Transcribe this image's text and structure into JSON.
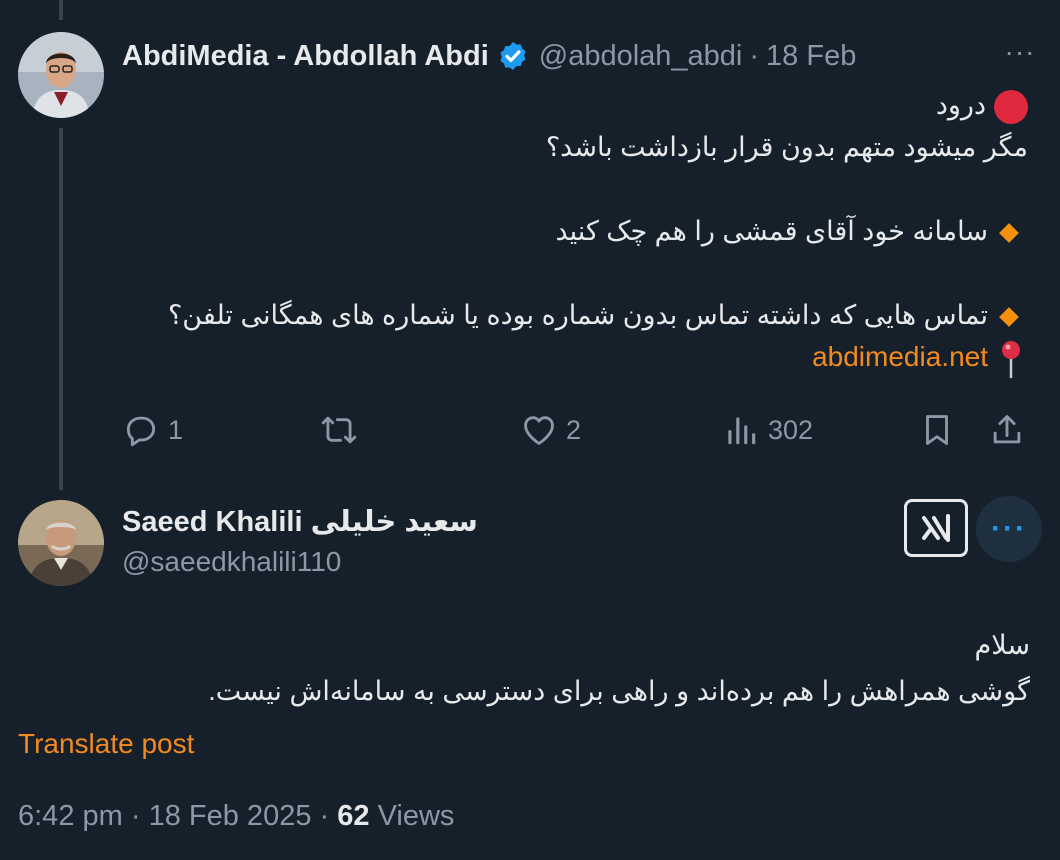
{
  "tweet1": {
    "display_name": "AbdiMedia - Abdollah Abdi",
    "handle": "@abdolah_abdi",
    "separator": "·",
    "date": "18 Feb",
    "more_label": "···",
    "lines": [
      "درود",
      "مگر میشود متهم بدون قرار بازداشت باشد؟",
      "سامانه خود آقای قمشی را هم چک کنید",
      "تماس هایی که داشته تماس بدون شماره بوده یا شماره های همگانی تلفن؟",
      "abdimedia.net"
    ],
    "actions": {
      "replies": "1",
      "likes": "2",
      "views": "302"
    }
  },
  "tweet2": {
    "display_name": "Saeed Khalili سعید خلیلی",
    "handle": "@saeedkhalili110",
    "more_label": "···",
    "lines": [
      "سلام",
      "گوشی همراهش را هم برده‌اند و راهی  برای دسترسی به سامانه‌اش نیست."
    ],
    "translate_label": "Translate post",
    "time": "6:42 pm",
    "separator": "·",
    "date": "18 Feb 2025",
    "views_count": "62",
    "views_label": "Views"
  },
  "colors": {
    "background": "#15202b",
    "text": "#e7e9ea",
    "muted": "#8b98a5",
    "accent": "#f48a1f",
    "verified": "#1d9bf0"
  },
  "icons": [
    "verified-badge-icon",
    "red-circle-icon",
    "orange-diamond-icon",
    "round-pushpin-icon",
    "reply-icon",
    "repost-icon",
    "like-icon",
    "views-icon",
    "bookmark-icon",
    "share-icon",
    "grok-icon",
    "more-icon"
  ]
}
